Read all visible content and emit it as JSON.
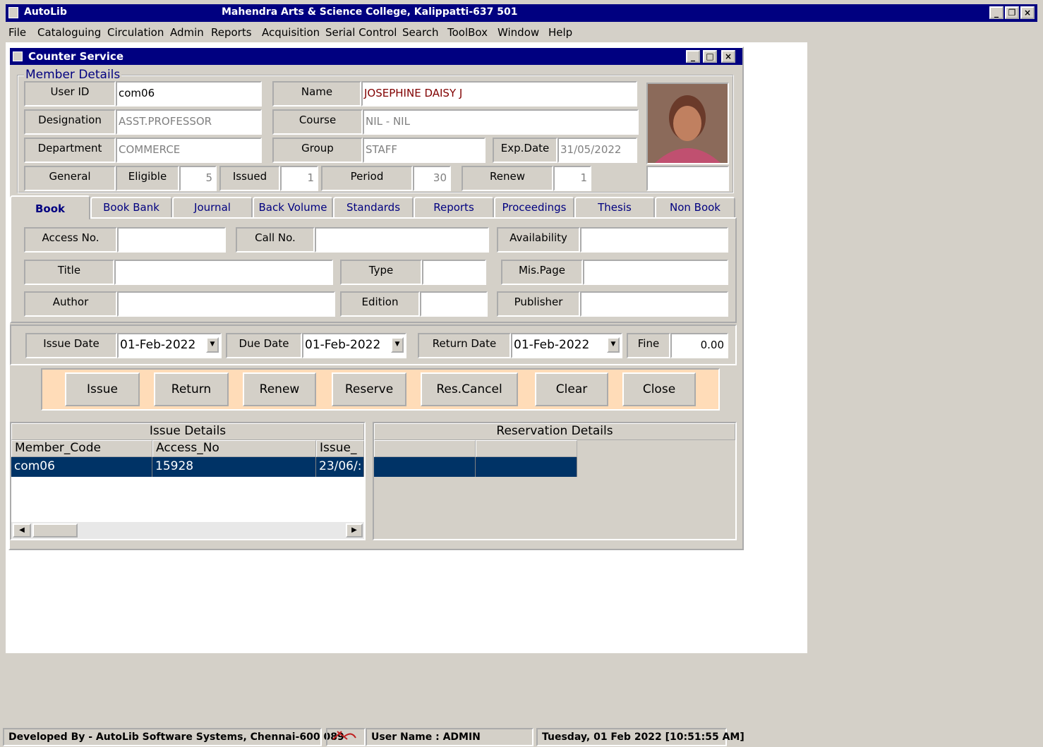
{
  "app": {
    "title": "AutoLib",
    "center_title": "Mahendra Arts & Science College, Kalippatti-637 501"
  },
  "menu": [
    "File",
    "Cataloguing",
    "Circulation",
    "Admin",
    "Reports",
    "Acquisition",
    "Serial Control",
    "Search",
    "ToolBox",
    "Window",
    "Help"
  ],
  "window": {
    "title": "Counter Service"
  },
  "member": {
    "legend": "Member Details",
    "user_id_label": "User ID",
    "user_id": "com06",
    "name_label": "Name",
    "name": "JOSEPHINE DAISY J",
    "designation_label": "Designation",
    "designation": "ASST.PROFESSOR",
    "course_label": "Course",
    "course": "NIL - NIL",
    "department_label": "Department",
    "department": "COMMERCE",
    "group_label": "Group",
    "group": "STAFF",
    "exp_label": "Exp.Date",
    "exp_date": "31/05/2022",
    "general_label": "General",
    "eligible_label": "Eligible",
    "eligible": "5",
    "issued_label": "Issued",
    "issued": "1",
    "period_label": "Period",
    "period": "30",
    "renew_label": "Renew",
    "renew": "1"
  },
  "tabs": [
    "Book",
    "Book Bank",
    "Journal",
    "Back Volume",
    "Standards",
    "Reports",
    "Proceedings",
    "Thesis",
    "Non Book"
  ],
  "book": {
    "access_label": "Access No.",
    "call_label": "Call No.",
    "availability_label": "Availability",
    "title_label": "Title",
    "type_label": "Type",
    "mispage_label": "Mis.Page",
    "author_label": "Author",
    "edition_label": "Edition",
    "publisher_label": "Publisher"
  },
  "dates": {
    "issue_label": "Issue Date",
    "issue_date": "01-Feb-2022",
    "due_label": "Due Date",
    "due_date": "01-Feb-2022",
    "return_label": "Return Date",
    "return_date": "01-Feb-2022",
    "fine_label": "Fine",
    "fine": "0.00"
  },
  "buttons": [
    "Issue",
    "Return",
    "Renew",
    "Reserve",
    "Res.Cancel",
    "Clear",
    "Close"
  ],
  "issue_details": {
    "title": "Issue Details",
    "columns": [
      "Member_Code",
      "Access_No",
      "Issue_"
    ],
    "rows": [
      [
        "com06",
        "15928",
        "23/06/:"
      ]
    ]
  },
  "reservation_details": {
    "title": "Reservation Details"
  },
  "status": {
    "developer": "Developed By -  AutoLib Software Systems, Chennai-600 089",
    "user": "User Name : ADMIN",
    "datetime": "Tuesday, 01 Feb 2022 [10:51:55 AM]"
  },
  "colors": {
    "title_bar": "#000080",
    "selection": "#003366",
    "button_strip": "#ffdcb8"
  }
}
